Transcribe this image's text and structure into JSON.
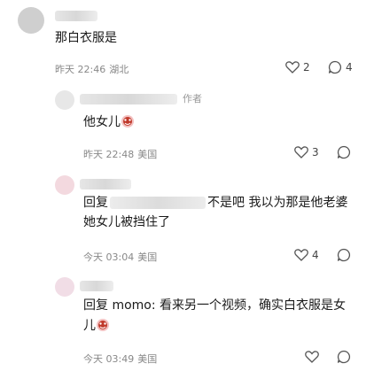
{
  "comments": [
    {
      "text": "那白衣服是",
      "time": "昨天 22:46",
      "location": "湖北",
      "likes": "2",
      "replies": "4"
    },
    {
      "author_tag": "作者",
      "text": "他女儿",
      "time": "昨天 22:48",
      "location": "美国",
      "likes": "3"
    },
    {
      "reply_prefix": "回复",
      "text_line1": "不是吧 我以为那是他老婆",
      "text_line2": "她女儿被挡住了",
      "time": "今天 03:04",
      "location": "美国",
      "likes": "4"
    },
    {
      "text_line1": "回复 momo: 看来另一个视频，确实白衣服是女",
      "text_line2": "儿",
      "time": "今天 03:49",
      "location": "美国"
    }
  ],
  "icons": [
    "heart-icon",
    "comment-icon",
    "laugh-emoji-icon"
  ],
  "colors": {
    "meta": "#888888",
    "text": "#1a1a1a",
    "icon": "#555555"
  }
}
